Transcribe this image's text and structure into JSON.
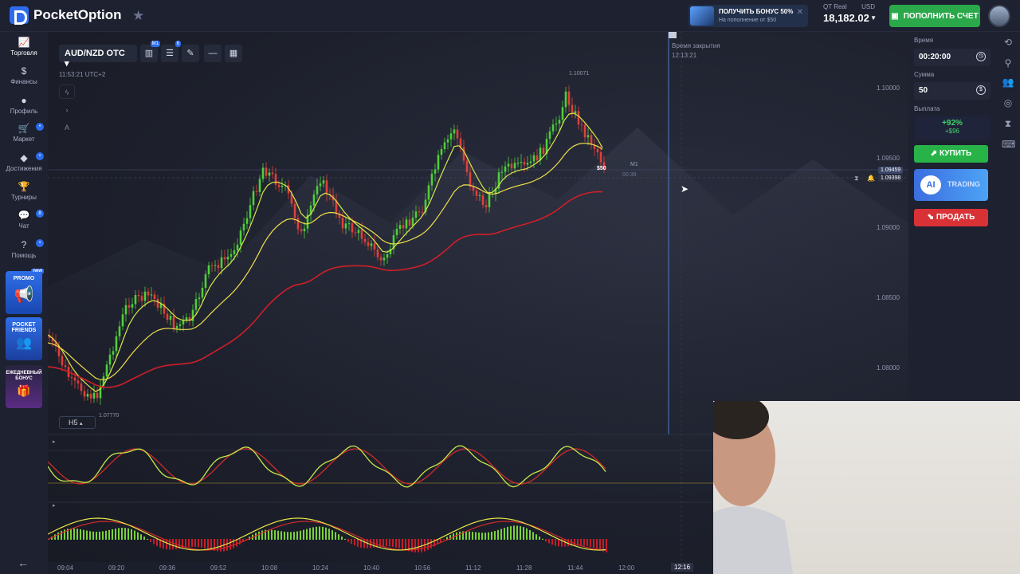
{
  "header": {
    "brand": "PocketOption",
    "bonus_title": "ПОЛУЧИТЬ БОНУС 50%",
    "bonus_sub": "На пополнение от $50",
    "account_type": "QT Real",
    "currency": "USD",
    "balance": "18,182.02",
    "deposit_label": "ПОПОЛНИТЬ СЧЕТ"
  },
  "sidebar": {
    "items": [
      {
        "label": "Торговля",
        "icon": "chart-icon"
      },
      {
        "label": "Финансы",
        "icon": "dollar-icon"
      },
      {
        "label": "Профиль",
        "icon": "user-icon"
      },
      {
        "label": "Маркет",
        "icon": "cart-icon"
      },
      {
        "label": "Достижения",
        "icon": "diamond-icon"
      },
      {
        "label": "Турниры",
        "icon": "trophy-icon"
      },
      {
        "label": "Чат",
        "icon": "chat-icon",
        "badge": "8"
      },
      {
        "label": "Помощь",
        "icon": "help-icon"
      }
    ],
    "promo1": "PROMO",
    "promo1_badge": "new",
    "promo2": "POCKET FRIENDS",
    "promo3": "ЕЖЕДНЕВНЫЙ БОНУС"
  },
  "chart": {
    "pair": "AUD/NZD OTC",
    "clock": "11:53:21 UTC+2",
    "close_time_label": "Время закрытия",
    "close_time": "12:13:21",
    "timeframe": "H5",
    "high_tag": "1.10071",
    "low_tag": "1.07770",
    "m1_tag": "M1",
    "countdown": "00:39",
    "bet_tag": "$50",
    "current_price": "1.09459",
    "ask_price": "1.09398",
    "price_axis": [
      "1.10000",
      "1.09500",
      "1.09000",
      "1.08500",
      "1.08000"
    ],
    "time_axis": [
      "09:04",
      "09:20",
      "09:36",
      "09:52",
      "10:08",
      "10:24",
      "10:40",
      "10:56",
      "11:12",
      "11:28",
      "11:44",
      "12:00",
      "12:16"
    ]
  },
  "panel": {
    "time_label": "Время",
    "time_value": "00:20:00",
    "amount_label": "Сумма",
    "amount_value": "50",
    "payout_label": "Выплата",
    "payout_pct": "+92%",
    "payout_amt": "+$96",
    "buy_label": "КУПИТЬ",
    "ai_label": "TRADING",
    "sell_label": "ПРОДАТЬ"
  },
  "colors": {
    "buy": "#27b348",
    "sell": "#d93236",
    "accent": "#2d6cf0"
  }
}
